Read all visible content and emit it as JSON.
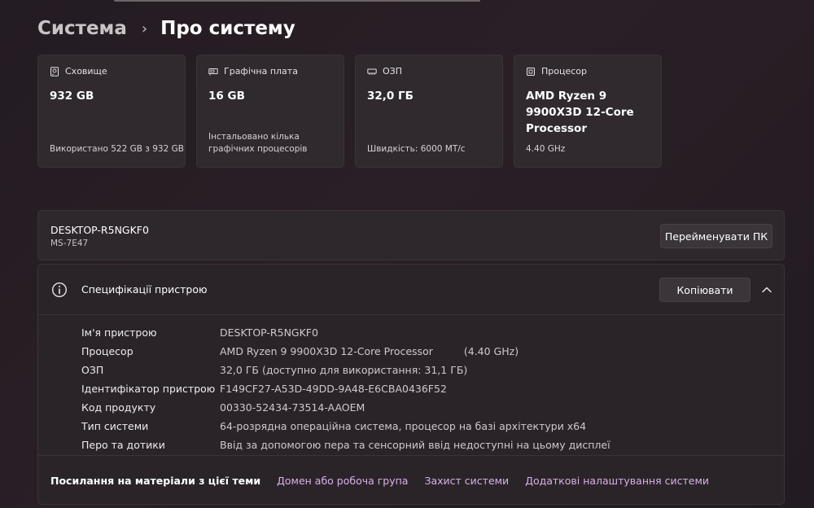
{
  "breadcrumb": {
    "parent": "Система",
    "separator": "›",
    "current": "Про систему"
  },
  "cards": {
    "storage": {
      "title": "Сховище",
      "value": "932 GB",
      "sub": "Використано 522 GB з 932 GB"
    },
    "gpu": {
      "title": "Графічна плата",
      "value": "16 GB",
      "sub": "Інстальовано кілька графічних процесорів"
    },
    "ram": {
      "title": "ОЗП",
      "value": "32,0 ГБ",
      "sub": "Швидкість: 6000 МТ/с"
    },
    "cpu": {
      "title": "Процесор",
      "value": "AMD Ryzen 9 9900X3D 12-Core Processor",
      "sub": "4.40 GHz"
    }
  },
  "device": {
    "name": "DESKTOP-R5NGKF0",
    "model": "MS-7E47",
    "rename_label": "Перейменувати ПК"
  },
  "specs": {
    "title": "Специфікації пристрою",
    "copy_label": "Копіювати",
    "rows": [
      {
        "label": "Ім'я пристрою",
        "value": "DESKTOP-R5NGKF0"
      },
      {
        "label": "Процесор",
        "value": "AMD Ryzen 9 9900X3D 12-Core Processor",
        "extra": "(4.40 GHz)"
      },
      {
        "label": "ОЗП",
        "value": "32,0 ГБ (доступно для використання: 31,1 ГБ)"
      },
      {
        "label": "Ідентифікатор пристрою",
        "value": "F149CF27-A53D-49DD-9A48-E6CBA0436F52"
      },
      {
        "label": "Код продукту",
        "value": "00330-52434-73514-AAOEM"
      },
      {
        "label": "Тип системи",
        "value": "64-розрядна операційна система, процесор на базі архітектури x64"
      },
      {
        "label": "Перо та дотики",
        "value": "Ввід за допомогою пера та сенсорний ввід недоступні на цьому дисплеї"
      }
    ]
  },
  "related": {
    "title": "Посилання на матеріали з цієї теми",
    "links": [
      "Домен або робоча група",
      "Захист системи",
      "Додаткові налаштування системи"
    ]
  },
  "icons": {
    "storage": "hard-drive-icon",
    "gpu": "graphics-card-icon",
    "ram": "memory-icon",
    "cpu": "processor-icon",
    "info": "info-icon",
    "collapse": "chevron-up-icon",
    "separator": "chevron-right-icon"
  },
  "colors": {
    "accent_link": "#d9b0e8",
    "background": "#231c22",
    "card": "#302a2f"
  }
}
